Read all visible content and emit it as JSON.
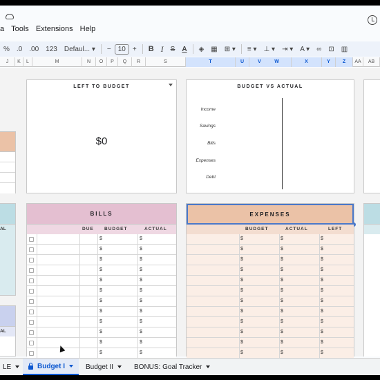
{
  "menu": {
    "items": [
      "a",
      "Tools",
      "Extensions",
      "Help"
    ]
  },
  "toolbar": {
    "dec_decimals": ".0",
    "inc_decimals": ".00",
    "format_123": "123",
    "font": "Defaul...",
    "minus": "−",
    "font_size": "10",
    "plus": "+",
    "bold": "B",
    "italic": "I",
    "strike": "S",
    "text_color": "A"
  },
  "columns": [
    {
      "label": "J",
      "selected": false
    },
    {
      "label": "K",
      "selected": false
    },
    {
      "label": "L",
      "selected": false
    },
    {
      "label": "M",
      "selected": false
    },
    {
      "label": "N",
      "selected": false
    },
    {
      "label": "O",
      "selected": false
    },
    {
      "label": "P",
      "selected": false
    },
    {
      "label": "Q",
      "selected": false
    },
    {
      "label": "R",
      "selected": false
    },
    {
      "label": "S",
      "selected": false
    },
    {
      "label": "T",
      "selected": true
    },
    {
      "label": "U",
      "selected": true
    },
    {
      "label": "V",
      "selected": true
    },
    {
      "label": "W",
      "selected": true
    },
    {
      "label": "X",
      "selected": true
    },
    {
      "label": "Y",
      "selected": true
    },
    {
      "label": "Z",
      "selected": true
    },
    {
      "label": "AA",
      "selected": false
    },
    {
      "label": "AB",
      "selected": false
    }
  ],
  "left_to_budget": {
    "title": "LEFT TO BUDGET",
    "value": "$0"
  },
  "budget_vs_actual": {
    "title": "BUDGET VS ACTUAL",
    "categories": [
      "Income",
      "Savings",
      "Bills",
      "Expenses",
      "Debt"
    ]
  },
  "bills": {
    "title": "BILLS",
    "headers": {
      "due": "DUE",
      "budget": "BUDGET",
      "actual": "ACTUAL"
    },
    "currency": "$",
    "color": "#e4bfd1"
  },
  "expenses": {
    "title": "EXPENSES",
    "headers": {
      "budget": "BUDGET",
      "actual": "ACTUAL",
      "left": "LEFT"
    },
    "currency": "$",
    "color": "#ebc2a7"
  },
  "left_stub": {
    "header_1": "AL",
    "header_2": "AL"
  },
  "sheet_tabs": {
    "first_partial": "LE",
    "budget_1": "Budget I",
    "budget_2": "Budget II",
    "bonus": "BONUS: Goal Tracker"
  }
}
